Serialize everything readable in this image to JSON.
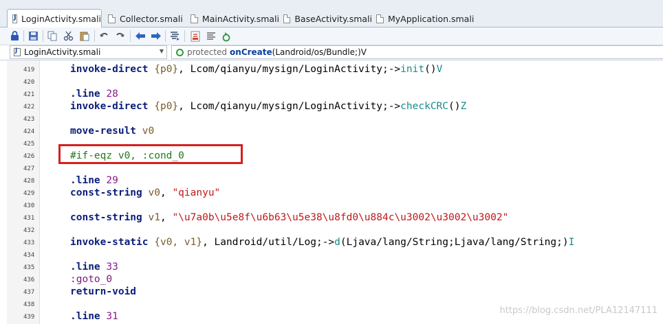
{
  "tabs": [
    {
      "label": "LoginActivity.smali",
      "active": true
    },
    {
      "label": "Collector.smali",
      "active": false
    },
    {
      "label": "MainActivity.smali",
      "active": false
    },
    {
      "label": "BaseActivity.smali",
      "active": false
    },
    {
      "label": "MyApplication.smali",
      "active": false
    }
  ],
  "toolbar": {
    "icons": [
      "lock-icon",
      "save-icon",
      "copy-icon",
      "cut-icon",
      "paste-icon",
      "undo-icon",
      "redo-icon",
      "back-arrow-icon",
      "forward-arrow-icon",
      "format-icon",
      "java-decompile-icon",
      "align-icon",
      "refresh-icon"
    ]
  },
  "selector": {
    "file": "LoginActivity.smali",
    "method_modifier": "protected",
    "method_name": "onCreate",
    "method_signature": "(Landroid/os/Bundle;)V"
  },
  "code_lines": [
    {
      "num": "419",
      "segments": [
        [
          "kw",
          "invoke-direct"
        ],
        [
          "plain",
          " "
        ],
        [
          "reg",
          "{p0}"
        ],
        [
          "plain",
          ", Lcom/qianyu/mysign/LoginActivity;->"
        ],
        [
          "meth",
          "init"
        ],
        [
          "plain",
          "()"
        ],
        [
          "meth",
          "V"
        ]
      ]
    },
    {
      "num": "420",
      "segments": []
    },
    {
      "num": "421",
      "segments": [
        [
          "dir",
          ".line"
        ],
        [
          "plain",
          " "
        ],
        [
          "num",
          "28"
        ]
      ]
    },
    {
      "num": "422",
      "segments": [
        [
          "kw",
          "invoke-direct"
        ],
        [
          "plain",
          " "
        ],
        [
          "reg",
          "{p0}"
        ],
        [
          "plain",
          ", Lcom/qianyu/mysign/LoginActivity;->"
        ],
        [
          "meth",
          "checkCRC"
        ],
        [
          "plain",
          "()"
        ],
        [
          "meth",
          "Z"
        ]
      ]
    },
    {
      "num": "423",
      "segments": []
    },
    {
      "num": "424",
      "segments": [
        [
          "kw",
          "move-result"
        ],
        [
          "plain",
          " "
        ],
        [
          "reg",
          "v0"
        ]
      ]
    },
    {
      "num": "425",
      "segments": []
    },
    {
      "num": "426",
      "segments": [
        [
          "comment",
          "#if-eqz v0, :cond_0"
        ]
      ]
    },
    {
      "num": "427",
      "segments": []
    },
    {
      "num": "428",
      "segments": [
        [
          "dir",
          ".line"
        ],
        [
          "plain",
          " "
        ],
        [
          "num",
          "29"
        ]
      ]
    },
    {
      "num": "429",
      "segments": [
        [
          "kw",
          "const-string"
        ],
        [
          "plain",
          " "
        ],
        [
          "reg",
          "v0"
        ],
        [
          "plain",
          ", "
        ],
        [
          "str",
          "\"qianyu\""
        ]
      ]
    },
    {
      "num": "430",
      "segments": []
    },
    {
      "num": "431",
      "segments": [
        [
          "kw",
          "const-string"
        ],
        [
          "plain",
          " "
        ],
        [
          "reg",
          "v1"
        ],
        [
          "plain",
          ", "
        ],
        [
          "str",
          "\"\\u7a0b\\u5e8f\\u6b63\\u5e38\\u8fd0\\u884c\\u3002\\u3002\\u3002\""
        ]
      ]
    },
    {
      "num": "432",
      "segments": []
    },
    {
      "num": "433",
      "segments": [
        [
          "kw",
          "invoke-static"
        ],
        [
          "plain",
          " "
        ],
        [
          "reg",
          "{v0, v1}"
        ],
        [
          "plain",
          ", Landroid/util/Log;->"
        ],
        [
          "meth",
          "d"
        ],
        [
          "plain",
          "(Ljava/lang/String;Ljava/lang/String;)"
        ],
        [
          "meth",
          "I"
        ]
      ]
    },
    {
      "num": "434",
      "segments": []
    },
    {
      "num": "435",
      "segments": [
        [
          "dir",
          ".line"
        ],
        [
          "plain",
          " "
        ],
        [
          "num",
          "33"
        ]
      ]
    },
    {
      "num": "436",
      "segments": [
        [
          "label",
          ":goto_0"
        ]
      ]
    },
    {
      "num": "437",
      "segments": [
        [
          "kw",
          "return-void"
        ]
      ]
    },
    {
      "num": "438",
      "segments": []
    },
    {
      "num": "439",
      "segments": [
        [
          "dir",
          ".line"
        ],
        [
          "plain",
          " "
        ],
        [
          "num",
          "31"
        ]
      ]
    }
  ],
  "watermark": "https://blog.csdn.net/PLA12147111"
}
